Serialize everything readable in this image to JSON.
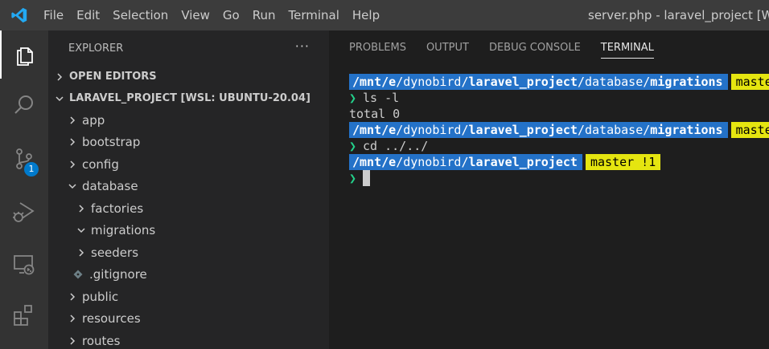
{
  "menu": [
    "File",
    "Edit",
    "Selection",
    "View",
    "Go",
    "Run",
    "Terminal",
    "Help"
  ],
  "window_title": "server.php - laravel_project [WSL: U",
  "activity": {
    "scm_badge": "1"
  },
  "sidebar": {
    "title": "EXPLORER",
    "more": "···",
    "open_editors": "OPEN EDITORS",
    "project": "LARAVEL_PROJECT [WSL: UBUNTU-20.04]",
    "items": [
      {
        "label": "app"
      },
      {
        "label": "bootstrap"
      },
      {
        "label": "config"
      },
      {
        "label": "database"
      },
      {
        "label": "factories"
      },
      {
        "label": "migrations"
      },
      {
        "label": "seeders"
      },
      {
        "label": ".gitignore"
      },
      {
        "label": "public"
      },
      {
        "label": "resources"
      },
      {
        "label": "routes"
      }
    ]
  },
  "panel": {
    "tabs": [
      "PROBLEMS",
      "OUTPUT",
      "DEBUG CONSOLE",
      "TERMINAL"
    ]
  },
  "terminal": {
    "p1": {
      "a": "/mnt/",
      "b": "e",
      "c": "/dynobird/",
      "d": "laravel_project",
      "e": "/database/",
      "f": "migrations",
      "branch": "master"
    },
    "cmd1": "ls -l",
    "out1": "total 0",
    "p2": {
      "a": "/mnt/",
      "b": "e",
      "c": "/dynobird/",
      "d": "laravel_project",
      "e": "/database/",
      "f": "migrations",
      "branch": "master"
    },
    "cmd2": "cd ../../",
    "p3": {
      "a": "/mnt/",
      "b": "e",
      "c": "/dynobird/",
      "d": "laravel_project",
      "branch": "master !1"
    },
    "arrow": "❯"
  }
}
